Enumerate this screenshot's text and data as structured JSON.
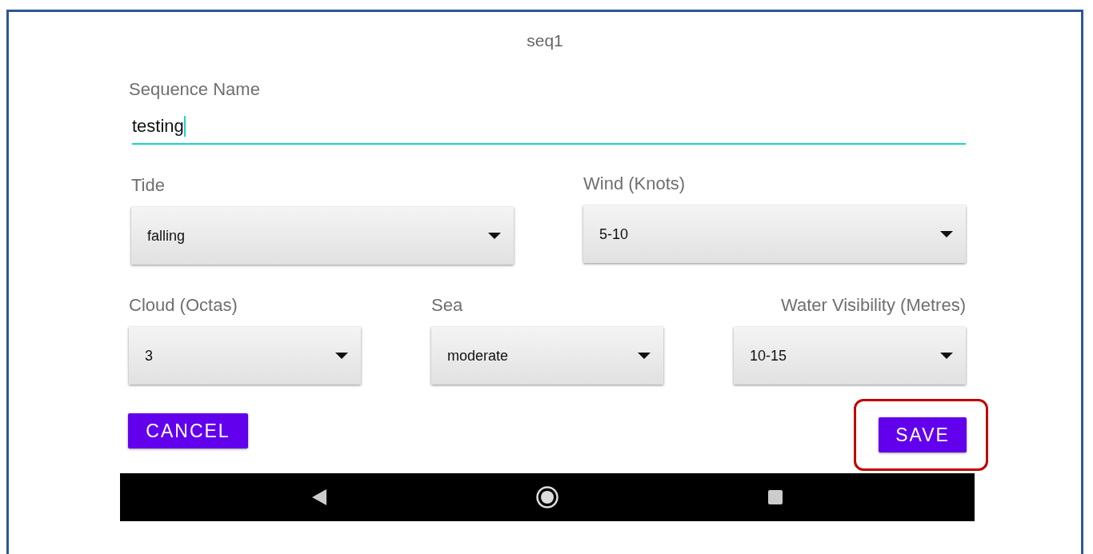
{
  "title": "seq1",
  "sequence_name": {
    "label": "Sequence Name",
    "value": "testing",
    "focused": true
  },
  "fields": [
    {
      "label": "Tide",
      "value": "falling"
    },
    {
      "label": "Wind (Knots)",
      "value": "5-10"
    },
    {
      "label": "Cloud (Octas)",
      "value": "3"
    },
    {
      "label": "Sea",
      "value": "moderate"
    },
    {
      "label": "Water Visibility (Metres)",
      "value": "10-15"
    }
  ],
  "buttons": [
    {
      "label": "CANCEL",
      "highlighted": false
    },
    {
      "label": "SAVE",
      "highlighted": true
    }
  ]
}
